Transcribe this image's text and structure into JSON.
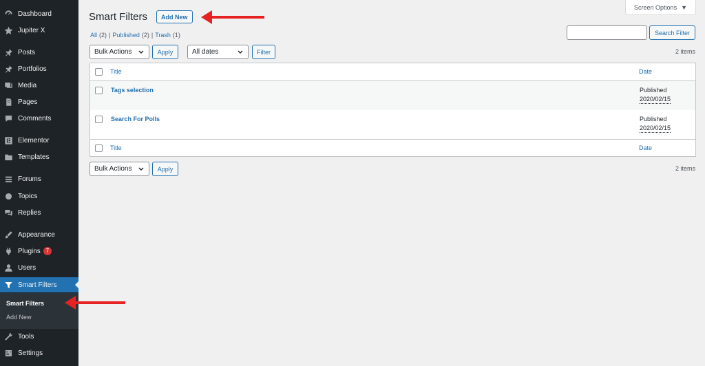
{
  "sidebar": {
    "items": [
      {
        "label": "Dashboard",
        "icon": "dashboard-icon"
      },
      {
        "label": "Jupiter X",
        "icon": "star-icon"
      },
      {
        "label": "Posts",
        "icon": "pin-icon"
      },
      {
        "label": "Portfolios",
        "icon": "pin-icon"
      },
      {
        "label": "Media",
        "icon": "media-icon"
      },
      {
        "label": "Pages",
        "icon": "page-icon"
      },
      {
        "label": "Comments",
        "icon": "comment-icon"
      },
      {
        "label": "Elementor",
        "icon": "elementor-icon"
      },
      {
        "label": "Templates",
        "icon": "folder-icon"
      },
      {
        "label": "Forums",
        "icon": "forum-icon"
      },
      {
        "label": "Topics",
        "icon": "topics-icon"
      },
      {
        "label": "Replies",
        "icon": "replies-icon"
      },
      {
        "label": "Appearance",
        "icon": "brush-icon"
      },
      {
        "label": "Plugins",
        "icon": "plugin-icon",
        "badge": "7"
      },
      {
        "label": "Users",
        "icon": "user-icon"
      },
      {
        "label": "Smart Filters",
        "icon": "filter-icon",
        "active": true
      },
      {
        "label": "Tools",
        "icon": "wrench-icon"
      },
      {
        "label": "Settings",
        "icon": "settings-icon"
      }
    ],
    "submenu": [
      "Smart Filters",
      "Add New"
    ]
  },
  "header": {
    "title": "Smart Filters",
    "add_new": "Add New",
    "screen_options": "Screen Options"
  },
  "views": {
    "all": "All",
    "all_count": "(2)",
    "published": "Published",
    "published_count": "(2)",
    "trash": "Trash",
    "trash_count": "(1)",
    "sep": "|"
  },
  "search": {
    "value": "",
    "button": "Search Filter"
  },
  "toolbar": {
    "bulk_actions": "Bulk Actions",
    "apply": "Apply",
    "all_dates": "All dates",
    "filter": "Filter",
    "items_count": "2 items"
  },
  "table": {
    "columns": {
      "title": "Title",
      "date": "Date"
    },
    "rows": [
      {
        "title": "Tags selection",
        "status": "Published",
        "date": "2020/02/15"
      },
      {
        "title": "Search For Polls",
        "status": "Published",
        "date": "2020/02/15"
      }
    ]
  },
  "colors": {
    "sidebar": "#1d2327",
    "accent": "#2271b1",
    "arrow": "#e62222"
  }
}
